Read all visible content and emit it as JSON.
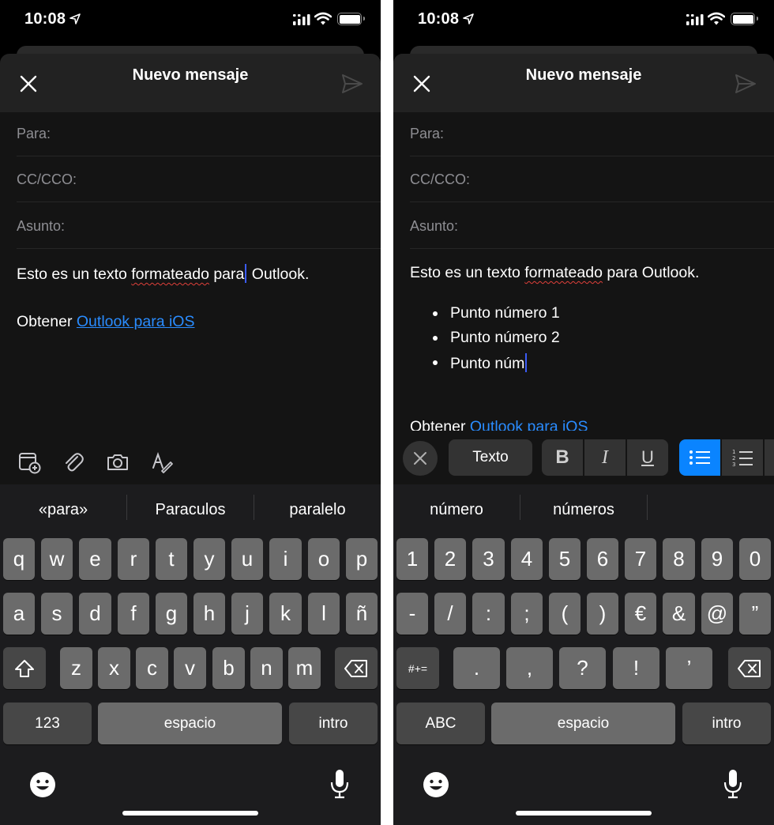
{
  "status": {
    "time": "10:08"
  },
  "compose": {
    "title": "Nuevo mensaje",
    "to_label": "Para:",
    "cc_label": "CC/CCO:",
    "subject_label": "Asunto:"
  },
  "left": {
    "body": {
      "prefix": "Esto es un texto ",
      "misspelled": "formateado",
      "mid": " para",
      "after_caret": " Outlook."
    },
    "signature": {
      "prefix": "Obtener ",
      "link": "Outlook para iOS"
    },
    "tools": [
      "calendar-add-icon",
      "paperclip-icon",
      "camera-icon",
      "text-format-icon"
    ],
    "suggestions": [
      "«para»",
      "Paraculos",
      "paralelo"
    ],
    "keyboard": {
      "row1": [
        "q",
        "w",
        "e",
        "r",
        "t",
        "y",
        "u",
        "i",
        "o",
        "p"
      ],
      "row2": [
        "a",
        "s",
        "d",
        "f",
        "g",
        "h",
        "j",
        "k",
        "l",
        "ñ"
      ],
      "row3": [
        "z",
        "x",
        "c",
        "v",
        "b",
        "n",
        "m"
      ],
      "numbers_key": "123",
      "space_key": "espacio",
      "return_key": "intro"
    }
  },
  "right": {
    "body": {
      "prefix": "Esto es un texto ",
      "misspelled": "formateado",
      "suffix": " para Outlook."
    },
    "bullets": [
      "Punto número 1",
      "Punto número 2",
      "Punto núm"
    ],
    "signature": {
      "prefix": "Obtener ",
      "link": "Outlook para iOS"
    },
    "format_bar": {
      "style_label": "Texto",
      "bold": "B",
      "italic": "I",
      "underline": "U"
    },
    "suggestions": [
      "número",
      "números"
    ],
    "keyboard": {
      "row1": [
        "1",
        "2",
        "3",
        "4",
        "5",
        "6",
        "7",
        "8",
        "9",
        "0"
      ],
      "row2": [
        "-",
        "/",
        ":",
        ";",
        "(",
        ")",
        "€",
        "&",
        "@",
        "”"
      ],
      "row3": [
        ".",
        ",",
        "?",
        "!",
        "’"
      ],
      "symbols_key": "#+=",
      "letters_key": "ABC",
      "space_key": "espacio",
      "return_key": "intro"
    }
  },
  "colors": {
    "link": "#2a8cff",
    "accent": "#0a84ff",
    "caret": "#3b5cf5"
  }
}
